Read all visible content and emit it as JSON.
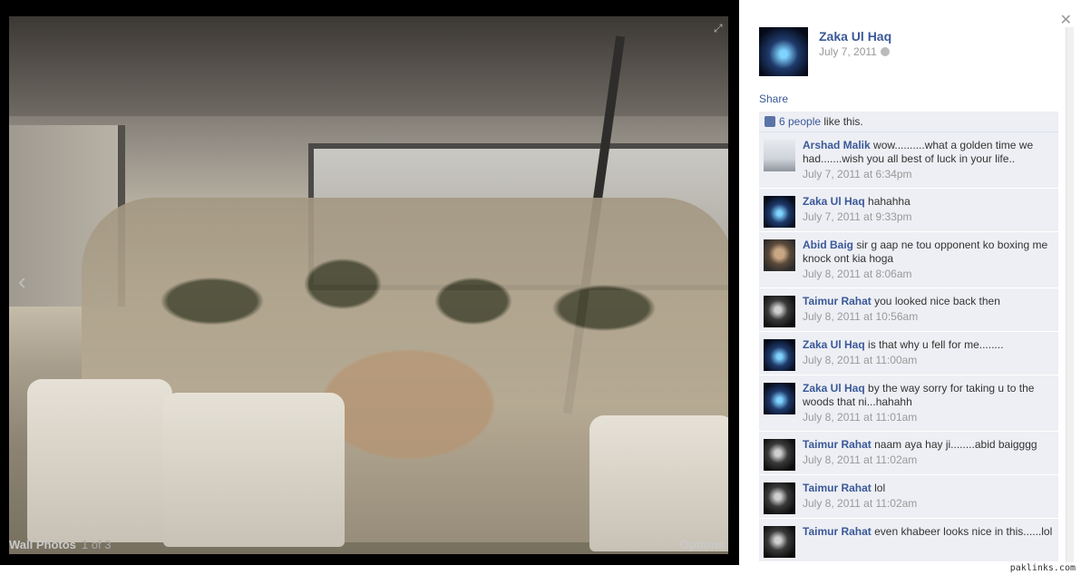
{
  "photo_viewer": {
    "album_label": "Wall Photos",
    "position_label": "1 of 3",
    "right_label": "Options"
  },
  "post": {
    "author": "Zaka Ul Haq",
    "date": "July 7, 2011",
    "share_label": "Share",
    "likes": {
      "link_text": "6 people",
      "suffix": " like this."
    }
  },
  "comments": [
    {
      "name": "Arshad Malik",
      "text": " wow..........what a golden time we had.......wish you all best of luck in your life..",
      "time": "July 7, 2011 at 6:34pm",
      "avatar": "av-snow"
    },
    {
      "name": "Zaka Ul Haq",
      "text": " hahahha",
      "time": "July 7, 2011 at 9:33pm",
      "avatar": "av-blue"
    },
    {
      "name": "Abid Baig",
      "text": " sir g aap ne tou opponent ko boxing me knock ont kia hoga",
      "time": "July 8, 2011 at 8:06am",
      "avatar": "av-face"
    },
    {
      "name": "Taimur Rahat",
      "text": " you looked nice back then",
      "time": "July 8, 2011 at 10:56am",
      "avatar": "av-dark"
    },
    {
      "name": "Zaka Ul Haq",
      "text": " is that why u fell for me........",
      "time": "July 8, 2011 at 11:00am",
      "avatar": "av-blue"
    },
    {
      "name": "Zaka Ul Haq",
      "text": " by the way sorry for taking u to the woods that ni...hahahh",
      "time": "July 8, 2011 at 11:01am",
      "avatar": "av-blue"
    },
    {
      "name": "Taimur Rahat",
      "text": " naam aya hay ji........abid baigggg",
      "time": "July 8, 2011 at 11:02am",
      "avatar": "av-dark"
    },
    {
      "name": "Taimur Rahat",
      "text": " lol",
      "time": "July 8, 2011 at 11:02am",
      "avatar": "av-dark"
    },
    {
      "name": "Taimur Rahat",
      "text": " even khabeer looks nice in this......lol",
      "time": "",
      "avatar": "av-dark"
    }
  ],
  "watermark": "paklinks.com"
}
